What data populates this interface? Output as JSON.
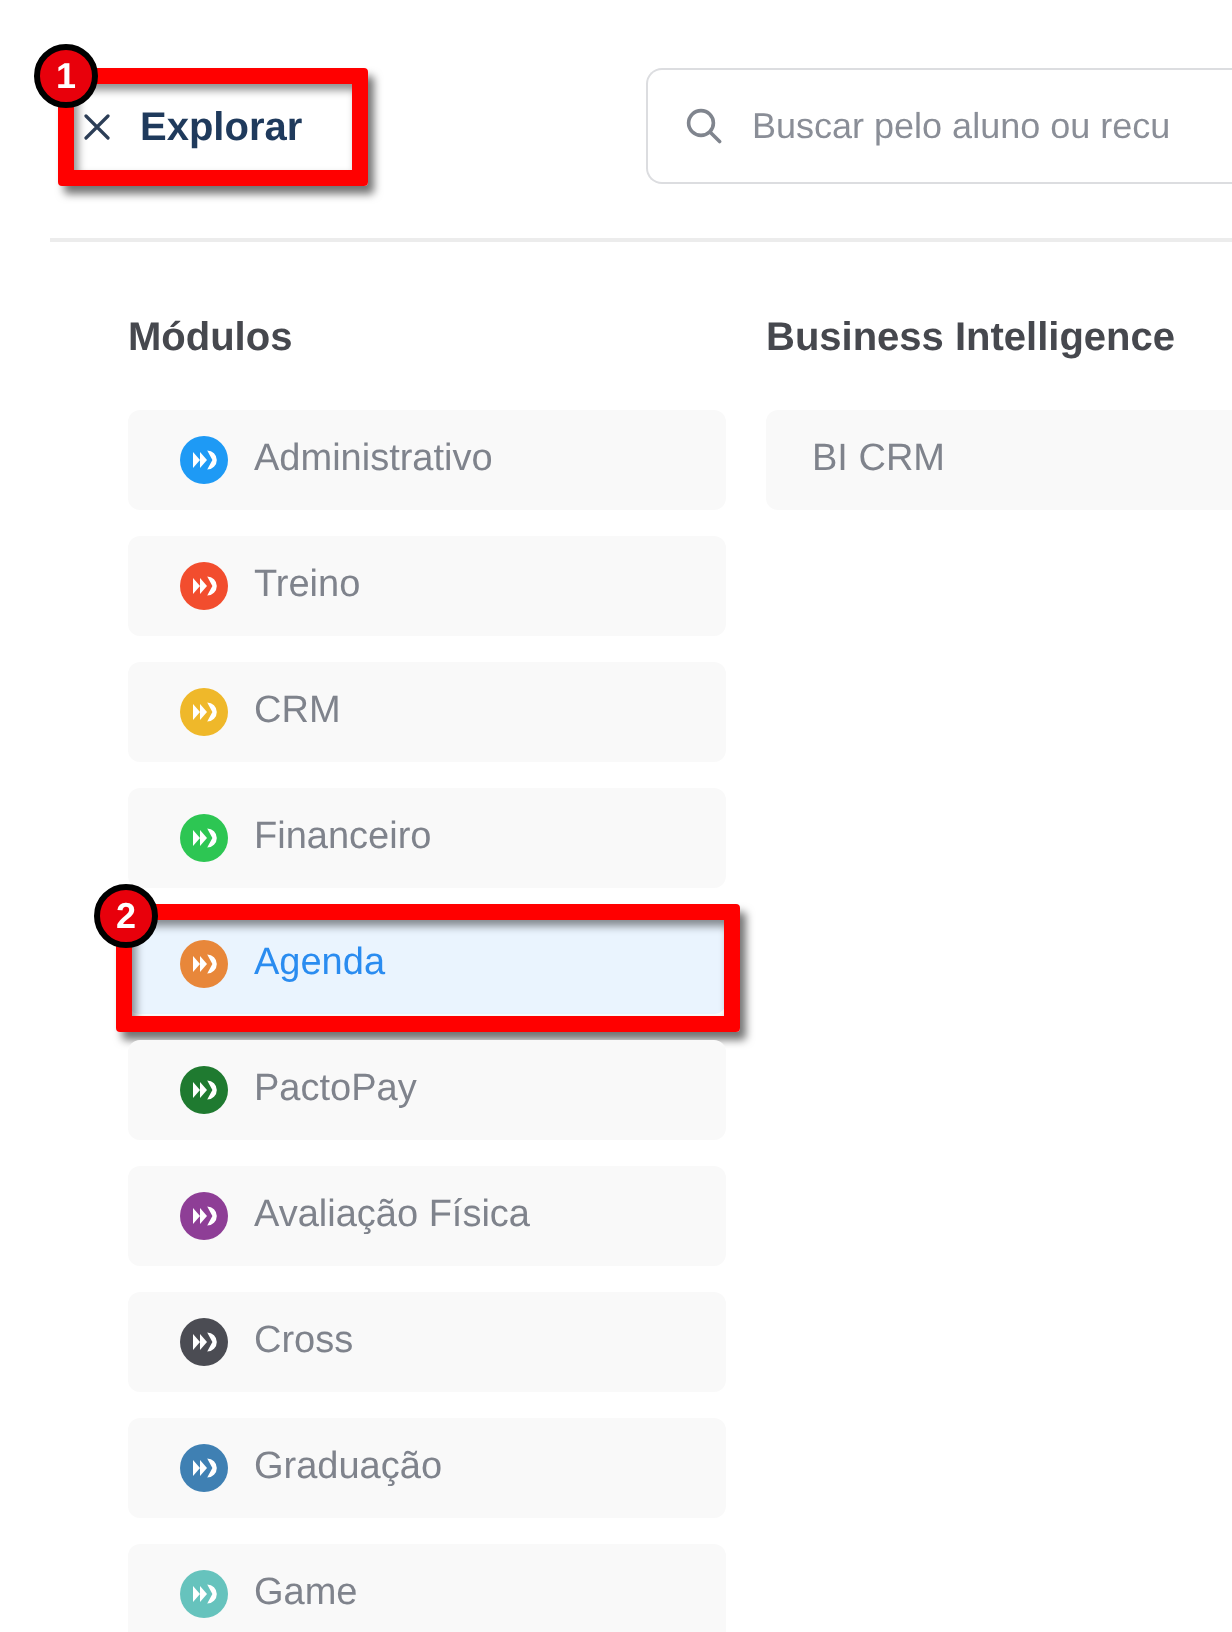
{
  "header": {
    "explore_button": {
      "label": "Explorar",
      "callout": "1"
    },
    "search": {
      "placeholder": "Buscar pelo aluno ou recu"
    }
  },
  "columns": [
    {
      "title": "Módulos",
      "items": [
        {
          "label": "Administrativo",
          "color": "#1e9af5",
          "selected": false
        },
        {
          "label": "Treino",
          "color": "#f24d2e",
          "selected": false
        },
        {
          "label": "CRM",
          "color": "#efb82a",
          "selected": false
        },
        {
          "label": "Financeiro",
          "color": "#2dc653",
          "selected": false
        },
        {
          "label": "Agenda",
          "color": "#e8873a",
          "selected": true,
          "callout": "2"
        },
        {
          "label": "PactoPay",
          "color": "#1f7a30",
          "selected": false
        },
        {
          "label": "Avaliação Física",
          "color": "#8e3e96",
          "selected": false
        },
        {
          "label": "Cross",
          "color": "#4b4c53",
          "selected": false
        },
        {
          "label": "Graduação",
          "color": "#3f80b3",
          "selected": false
        },
        {
          "label": "Game",
          "color": "#66c3bd",
          "selected": false
        }
      ]
    },
    {
      "title": "Business Intelligence",
      "items": [
        {
          "label": "BI CRM",
          "selected": false
        }
      ]
    }
  ]
}
